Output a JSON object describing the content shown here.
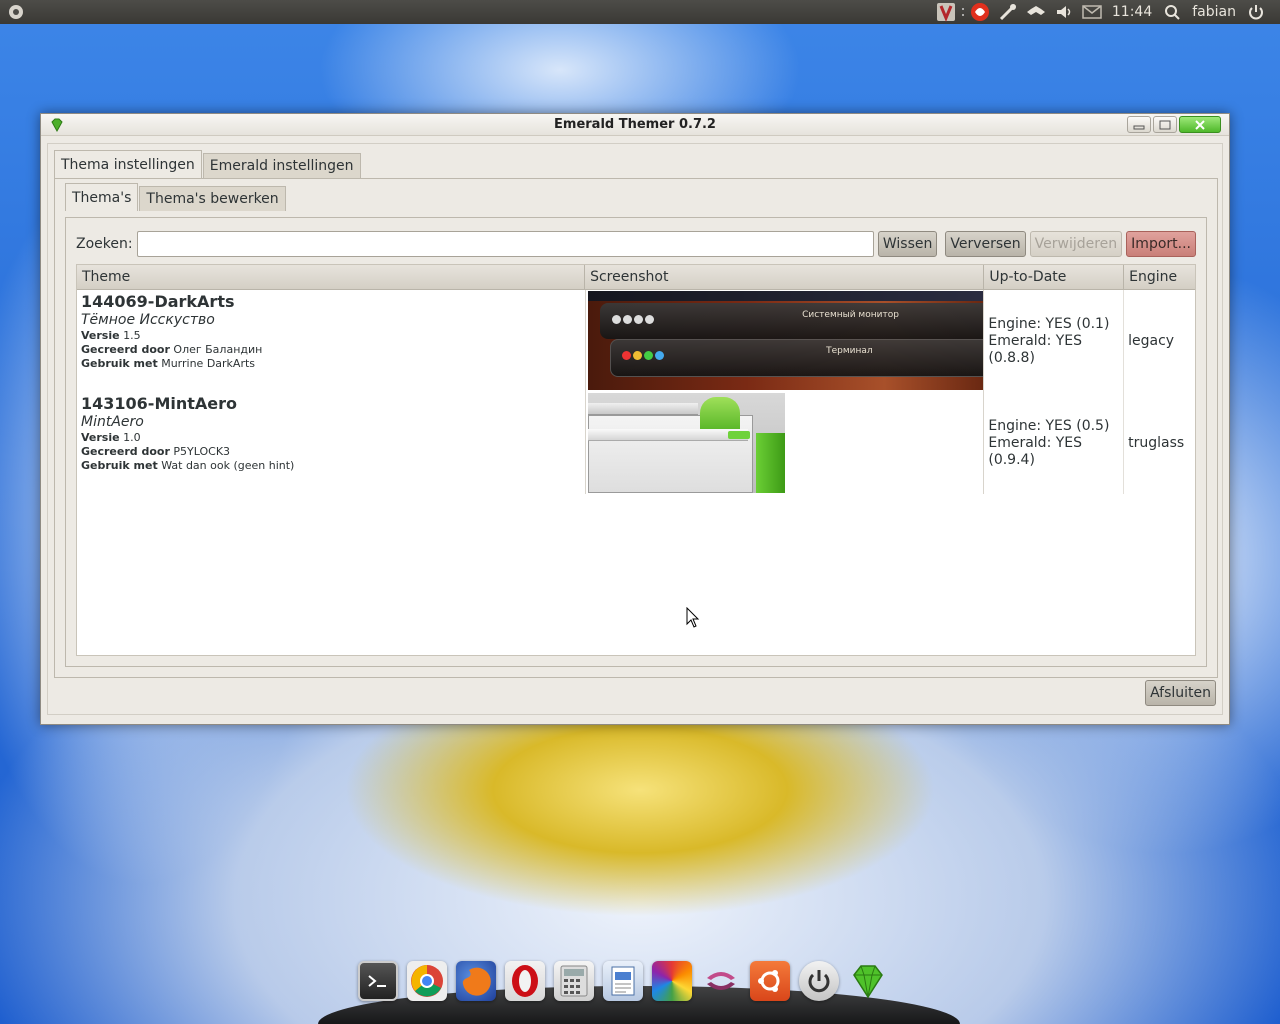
{
  "panel": {
    "clock": "11:44",
    "user": "fabian"
  },
  "window": {
    "title": "Emerald Themer 0.7.2"
  },
  "outer_tabs": [
    {
      "label": "Thema instellingen",
      "active": true
    },
    {
      "label": "Emerald instellingen",
      "active": false
    }
  ],
  "inner_tabs": [
    {
      "label": "Thema's",
      "active": true
    },
    {
      "label": "Thema's bewerken",
      "active": false
    }
  ],
  "search": {
    "label": "Zoeken:",
    "value": ""
  },
  "buttons": {
    "clear": "Wissen",
    "refresh": "Verversen",
    "delete": "Verwijderen",
    "import": "Import...",
    "close": "Afsluiten"
  },
  "columns": [
    "Theme",
    "Screenshot",
    "Up-to-Date",
    "Engine"
  ],
  "themes": [
    {
      "name": "144069-DarkArts",
      "description": "Тёмное Исскуство",
      "version_label": "Versie",
      "version": "1.5",
      "creator_label": "Gecreerd door",
      "creator": "Олег Баландин",
      "use_label": "Gebruik met",
      "use_with": "Murrine DarkArts",
      "engine_status": "Engine: YES (0.1)",
      "emerald_status": "Emerald: YES (0.8.8)",
      "engine": "legacy",
      "shot_labels": [
        "Системный монитор",
        "Терминал"
      ]
    },
    {
      "name": "143106-MintAero",
      "description": "MintAero",
      "version_label": "Versie",
      "version": "1.0",
      "creator_label": "Gecreerd door",
      "creator": "P5YLOCK3",
      "use_label": "Gebruik met",
      "use_with": "Wat dan ook (geen hint)",
      "engine_status": "Engine: YES (0.5)",
      "emerald_status": "Emerald: YES (0.9.4)",
      "engine": "truglass",
      "shot_labels": []
    }
  ],
  "dock_icons": [
    "terminal-icon",
    "chrome-icon",
    "firefox-icon",
    "opera-icon",
    "calculator-icon",
    "writer-icon",
    "color-wheel-icon",
    "sync-icon",
    "ubuntu-icon",
    "power-icon",
    "emerald-icon"
  ],
  "colors": {
    "desktop_blue": "#2a6fd9",
    "window_bg": "#edeae4",
    "close_button": "#4fb82a",
    "import_button": "#c97f78"
  }
}
